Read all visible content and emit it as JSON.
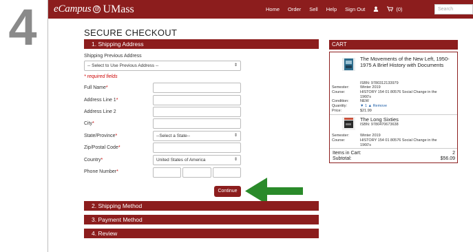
{
  "step_badge": "4",
  "header": {
    "logo_ecampus": "eCampus",
    "logo_at": "@",
    "logo_umass": "UMass",
    "nav": [
      "Home",
      "Order",
      "Sell",
      "Help",
      "Sign Out"
    ],
    "cart_count": "(0)",
    "search_placeholder": "Search"
  },
  "page_title": "SECURE CHECKOUT",
  "sections": {
    "shipping_address": "1. Shipping Address",
    "shipping_method": "2. Shipping Method",
    "payment_method": "3. Payment Method",
    "review": "4. Review"
  },
  "form": {
    "prev_address_label": "Shipping Previous Address",
    "prev_address_select": "-- Select to Use Previous Address --",
    "required_note": "* required fields",
    "full_name": "Full Name",
    "address1": "Address Line 1",
    "address2": "Address Line 2",
    "city": "City",
    "state": "State/Province",
    "state_select": "--Select a State--",
    "zip": "Zip/Postal Code",
    "country": "Country",
    "country_select": "United States of America",
    "phone": "Phone Number",
    "star": "*",
    "continue": "Continue"
  },
  "cart": {
    "title": "CART",
    "items": [
      {
        "title": "The Movements of the New Left, 1950-1975 A Brief History with Documents",
        "isbn": "ISBN: 9780312133979",
        "semester_label": "Semester:",
        "semester": "Winter 2019",
        "course_label": "Course:",
        "course": "HISTORY 154 01 80576 Social Change in the 1960's",
        "condition_label": "Condition:",
        "condition": "NEW",
        "quantity_label": "Quantity:",
        "quantity": "1",
        "remove": "Remove",
        "price_label": "Price:",
        "price": "$21.99"
      },
      {
        "title": "The Long Sixties",
        "isbn": "ISBN: 9780470673638",
        "semester_label": "Semester:",
        "semester": "Winter 2019",
        "course_label": "Course:",
        "course": "HISTORY 154 01 80576 Social Change in the 1960's"
      }
    ],
    "items_in_cart_label": "Items in Cart:",
    "items_in_cart": "2",
    "subtotal_label": "Subtotal:",
    "subtotal": "$56.09"
  },
  "colors": {
    "brand": "#8c1d1d",
    "arrow": "#2a8a2a",
    "required": "#cc0000"
  }
}
